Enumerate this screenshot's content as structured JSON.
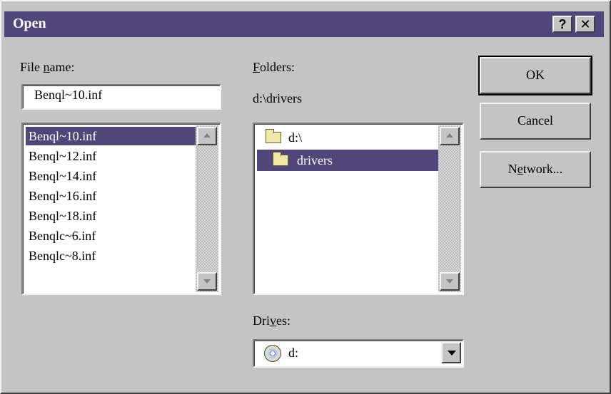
{
  "window": {
    "title": "Open",
    "help_glyph": "?",
    "close_glyph": "✕"
  },
  "file_name": {
    "label_prefix": "File ",
    "label_underlined": "n",
    "label_suffix": "ame:",
    "value": "Benql~10.inf"
  },
  "file_list": {
    "items": [
      "Benql~10.inf",
      "Benql~12.inf",
      "Benql~14.inf",
      "Benql~16.inf",
      "Benql~18.inf",
      "Benqlc~6.inf",
      "Benqlc~8.inf"
    ],
    "selected_index": 0
  },
  "folders": {
    "label_underlined": "F",
    "label_suffix": "olders:",
    "current_path": "d:\\drivers",
    "items": [
      {
        "name": "d:\\",
        "icon": "open-folder-icon"
      },
      {
        "name": "drivers",
        "icon": "open-folder-icon"
      }
    ],
    "selected_index": 1
  },
  "drives": {
    "label_prefix": "Dri",
    "label_underlined": "v",
    "label_suffix": "es:",
    "selected": "d:",
    "icon": "cd-drive-icon"
  },
  "buttons": {
    "ok": "OK",
    "cancel": "Cancel",
    "network_prefix": "N",
    "network_underlined": "e",
    "network_suffix": "twork..."
  },
  "colors": {
    "title_bar": "#50467a",
    "selection": "#50467a",
    "face": "#c4c4c4"
  }
}
